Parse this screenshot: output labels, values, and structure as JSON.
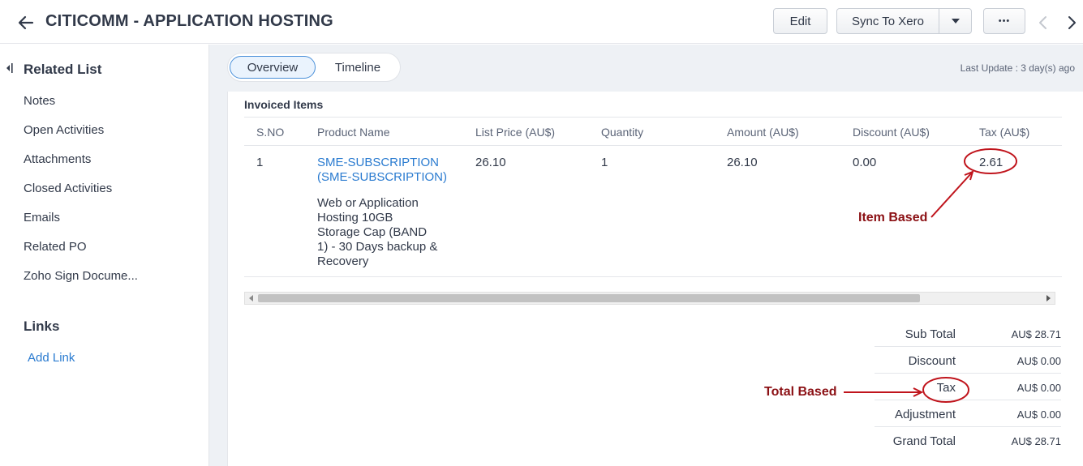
{
  "header": {
    "title": "CITICOMM - APPLICATION HOSTING",
    "edit_label": "Edit",
    "sync_label": "Sync To Xero",
    "more_label": "•••"
  },
  "sidebar": {
    "related_heading": "Related List",
    "items": [
      {
        "label": "Notes"
      },
      {
        "label": "Open Activities"
      },
      {
        "label": "Attachments"
      },
      {
        "label": "Closed Activities"
      },
      {
        "label": "Emails"
      },
      {
        "label": "Related PO"
      },
      {
        "label": "Zoho Sign Docume..."
      }
    ],
    "links_heading": "Links",
    "add_link_label": "Add Link"
  },
  "tabs": [
    {
      "label": "Overview",
      "active": true
    },
    {
      "label": "Timeline",
      "active": false
    }
  ],
  "last_update": "Last Update : 3 day(s) ago",
  "invoiced_items": {
    "title": "Invoiced Items",
    "columns": [
      "S.NO",
      "Product Name",
      "List Price (AU$)",
      "Quantity",
      "Amount (AU$)",
      "Discount (AU$)",
      "Tax (AU$)"
    ],
    "rows": [
      {
        "sno": "1",
        "product_name": "SME-SUBSCRIPTION (SME-SUBSCRIPTION)",
        "description": "Web or Application Hosting 10GB Storage Cap (BAND 1) - 30 Days backup & Recovery",
        "list_price": "26.10",
        "quantity": "1",
        "amount": "26.10",
        "discount": "0.00",
        "tax": "2.61"
      }
    ],
    "scroll_position": 0.82
  },
  "totals": [
    {
      "label": "Sub Total",
      "value": "AU$ 28.71"
    },
    {
      "label": "Discount",
      "value": "AU$ 0.00"
    },
    {
      "label": "Tax",
      "value": "AU$ 0.00"
    },
    {
      "label": "Adjustment",
      "value": "AU$ 0.00"
    },
    {
      "label": "Grand Total",
      "value": "AU$ 28.71"
    }
  ],
  "annotations": {
    "item_based": "Item Based",
    "total_based": "Total Based",
    "color": "#c0141c"
  },
  "colors": {
    "link": "#2a7bd0",
    "annotation_text": "#8b1014"
  }
}
